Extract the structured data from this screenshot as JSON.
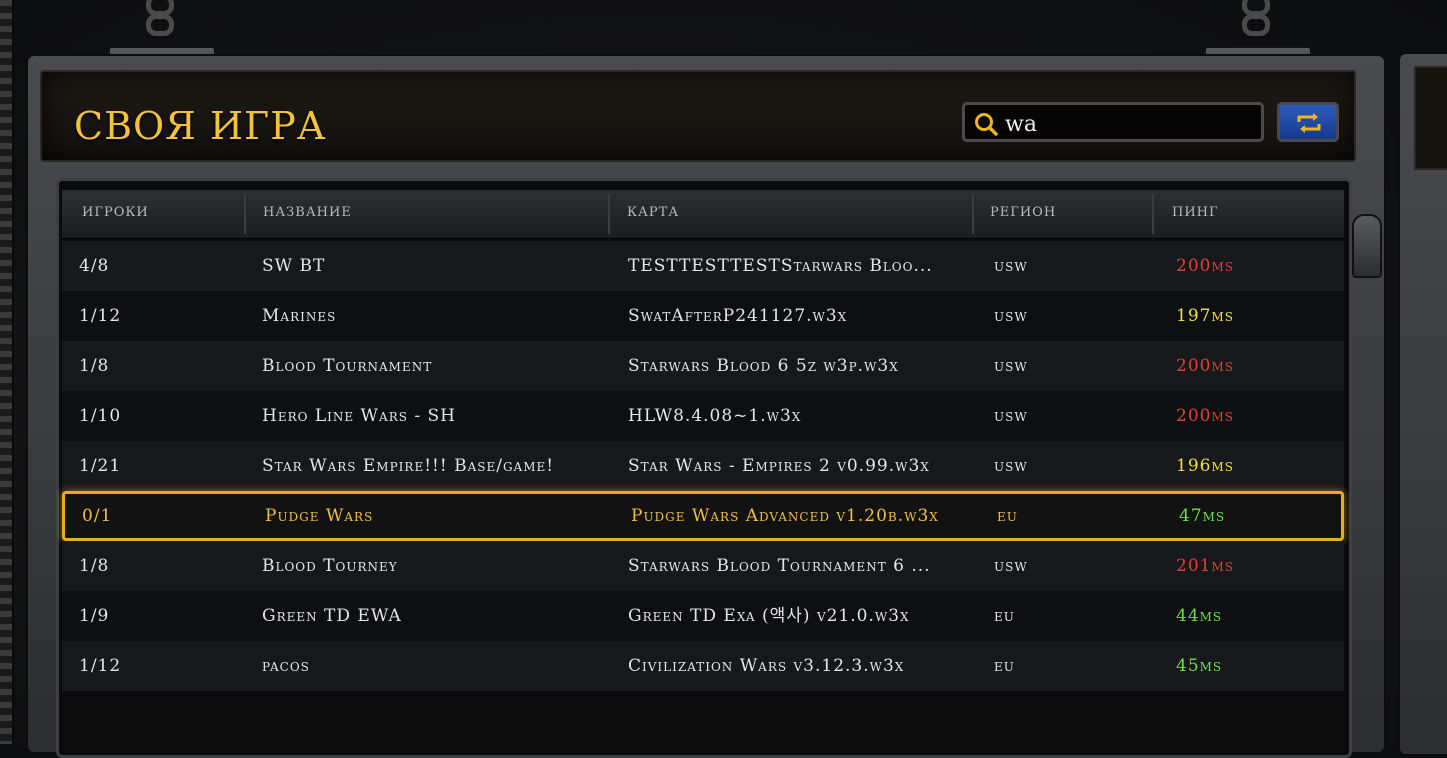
{
  "title": "СВОЯ ИГРА",
  "search": {
    "value": "wa",
    "placeholder": ""
  },
  "columns": {
    "players": "ИГРОКИ",
    "name": "НАЗВАНИЕ",
    "map": "КАРТА",
    "region": "РЕГИОН",
    "ping": "ПИНГ"
  },
  "games": [
    {
      "players": "4/8",
      "name": "SW BT",
      "map": "TESTTESTTESTStarwars Bloo...",
      "region": "usw",
      "ping": "200ms",
      "ping_level": "red"
    },
    {
      "players": "1/12",
      "name": "Marines",
      "map": "SwatAfterP241127.w3x",
      "region": "usw",
      "ping": "197ms",
      "ping_level": "yellow"
    },
    {
      "players": "1/8",
      "name": "Blood Tournament",
      "map": "Starwars Blood 6 5z w3p.w3x",
      "region": "usw",
      "ping": "200ms",
      "ping_level": "red"
    },
    {
      "players": "1/10",
      "name": "Hero Line Wars - SH",
      "map": "HLW8.4.08~1.w3x",
      "region": "usw",
      "ping": "200ms",
      "ping_level": "red"
    },
    {
      "players": "1/21",
      "name": "Star Wars Empire!!! Base/game!",
      "map": "Star Wars - Empires 2 v0.99.w3x",
      "region": "usw",
      "ping": "196ms",
      "ping_level": "yellow"
    },
    {
      "players": "0/1",
      "name": "Pudge Wars",
      "map": "Pudge Wars Advanced v1.20b.w3x",
      "region": "eu",
      "ping": "47ms",
      "ping_level": "green"
    },
    {
      "players": "1/8",
      "name": "Blood Tourney",
      "map": "Starwars Blood Tournament 6 ...",
      "region": "usw",
      "ping": "201ms",
      "ping_level": "red"
    },
    {
      "players": "1/9",
      "name": "Green TD EWA",
      "map": "Green TD Exa (액사) v21.0.w3x",
      "region": "eu",
      "ping": "44ms",
      "ping_level": "green"
    },
    {
      "players": "1/12",
      "name": "pacos",
      "map": "Civilization Wars v3.12.3.w3x",
      "region": "eu",
      "ping": "45ms",
      "ping_level": "green"
    }
  ],
  "selected_index": 5,
  "colors": {
    "title_gold": "#f2c33a",
    "selection_border": "#e7ad1e",
    "ping_red": "#e04038",
    "ping_yellow": "#f2e33a",
    "ping_green": "#6fe04a",
    "refresh_blue": "#2d5bbf"
  },
  "icons": {
    "search": "search-icon",
    "refresh": "refresh-icon"
  }
}
